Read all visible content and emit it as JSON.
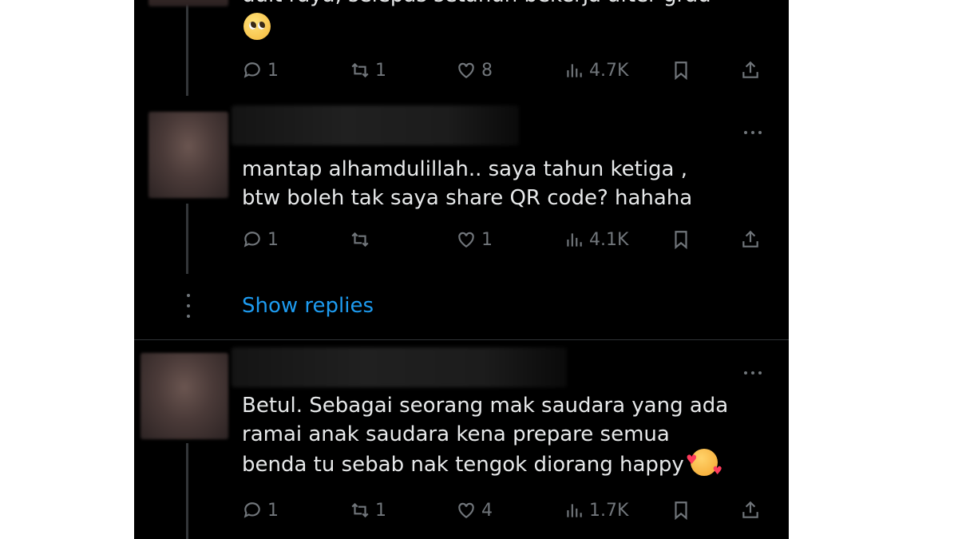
{
  "replies": [
    {
      "text_clipped": "duit raya, selepas setahun bekerja after grad",
      "emoji": "pleading-face",
      "actions": {
        "replies": "1",
        "reposts": "1",
        "likes": "8",
        "views": "4.7K"
      }
    },
    {
      "text": "mantap alhamdulillah.. saya tahun ketiga ,\nbtw boleh tak saya share QR code? hahaha",
      "actions": {
        "replies": "1",
        "reposts": "",
        "likes": "1",
        "views": "4.1K"
      }
    },
    {
      "text": "Betul. Sebagai seorang mak saudara yang ada\nramai anak saudara kena prepare semua\nbenda tu sebab nak tengok diorang happy ",
      "emoji": "smiling-face-with-hearts",
      "actions": {
        "replies": "1",
        "reposts": "1",
        "likes": "4",
        "views": "1.7K"
      }
    }
  ],
  "show_replies_label": "Show replies",
  "colors": {
    "background": "#000000",
    "text": "#e7e9ea",
    "muted": "#71767b",
    "link": "#1d9bf0"
  }
}
